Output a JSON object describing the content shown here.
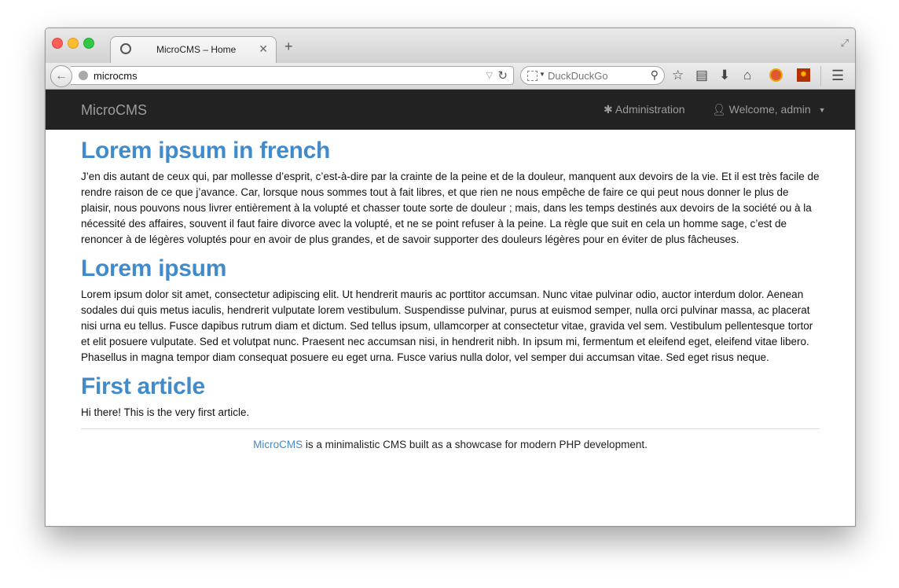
{
  "browser": {
    "tab_title": "MicroCMS – Home",
    "tab_close": "✕",
    "new_tab": "+",
    "url": "microcms",
    "search_placeholder": "DuckDuckGo"
  },
  "navbar": {
    "brand": "MicroCMS",
    "admin_label": "Administration",
    "user_label": "Welcome, admin"
  },
  "articles": [
    {
      "title": "Lorem ipsum in french",
      "body": "J’en dis autant de ceux qui, par mollesse d’esprit, c’est-à-dire par la crainte de la peine et de la douleur, manquent aux devoirs de la vie. Et il est très facile de rendre raison de ce que j’avance. Car, lorsque nous sommes tout à fait libres, et que rien ne nous empêche de faire ce qui peut nous donner le plus de plaisir, nous pouvons nous livrer entièrement à la volupté et chasser toute sorte de douleur ; mais, dans les temps destinés aux devoirs de la société ou à la nécessité des affaires, souvent il faut faire divorce avec la volupté, et ne se point refuser à la peine. La règle que suit en cela un homme sage, c’est de renoncer à de légères voluptés pour en avoir de plus grandes, et de savoir supporter des douleurs légères pour en éviter de plus fâcheuses."
    },
    {
      "title": "Lorem ipsum",
      "body": "Lorem ipsum dolor sit amet, consectetur adipiscing elit. Ut hendrerit mauris ac porttitor accumsan. Nunc vitae pulvinar odio, auctor interdum dolor. Aenean sodales dui quis metus iaculis, hendrerit vulputate lorem vestibulum. Suspendisse pulvinar, purus at euismod semper, nulla orci pulvinar massa, ac placerat nisi urna eu tellus. Fusce dapibus rutrum diam et dictum. Sed tellus ipsum, ullamcorper at consectetur vitae, gravida vel sem. Vestibulum pellentesque tortor et elit posuere vulputate. Sed et volutpat nunc. Praesent nec accumsan nisi, in hendrerit nibh. In ipsum mi, fermentum et eleifend eget, eleifend vitae libero. Phasellus in magna tempor diam consequat posuere eu eget urna. Fusce varius nulla dolor, vel semper dui accumsan vitae. Sed eget risus neque."
    },
    {
      "title": "First article",
      "body": "Hi there! This is the very first article."
    }
  ],
  "footer": {
    "link": "MicroCMS",
    "text": " is a minimalistic CMS built as a showcase for modern PHP development."
  }
}
